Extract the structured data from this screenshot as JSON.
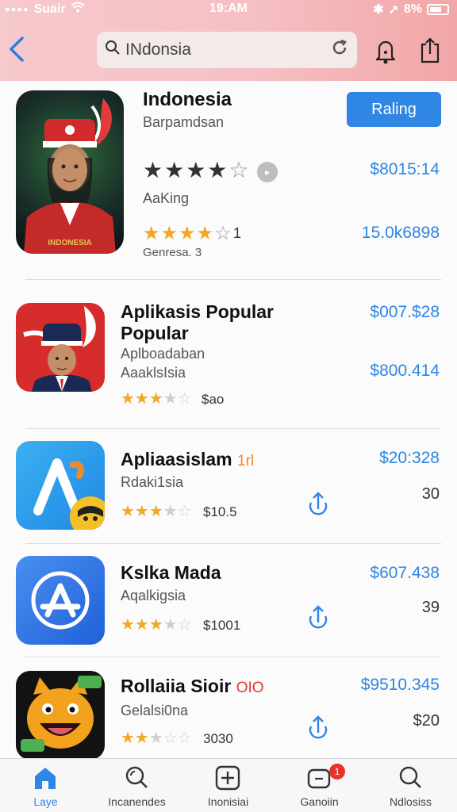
{
  "status_bar": {
    "carrier": "Suair",
    "time": "19:AM",
    "battery": "8%"
  },
  "search": {
    "query": "INdonsia"
  },
  "featured": {
    "title": "Indonesia",
    "subtitle": "Barpamdsan",
    "button": "Raling",
    "price_primary": "$8015:14",
    "label": "AaKing",
    "rating_count": "1",
    "price_secondary": "15.0k6898",
    "genre": "Genresa. 3",
    "image_caption": "INDONESIA"
  },
  "items": [
    {
      "title": "Aplikasis Popular Popular",
      "tag": "",
      "subtitle": "Aplboadaban",
      "subtitle2": "AaaklsIsia",
      "meta": "$ao",
      "price": "$007.$28",
      "price2": "$800.414",
      "rating": 3.5
    },
    {
      "title": "Apliaasislam",
      "tag": "1rl",
      "subtitle": "Rdaki1sia",
      "meta": "$10.5",
      "price": "$20:328",
      "num": "30",
      "rating": 3.5
    },
    {
      "title": "Kslka Mada",
      "tag": "",
      "subtitle": "Aqalkigsia",
      "meta": "$1001",
      "price": "$607.438",
      "num": "39",
      "rating": 3.5
    },
    {
      "title": "Rollaiia Sioir",
      "tag": "OIO",
      "subtitle": "Gelalsi0na",
      "meta": "3030",
      "price": "$9510.345",
      "num": "$20",
      "rating": 2.5
    }
  ],
  "tabs": [
    {
      "label": "Laye",
      "icon": "home-icon",
      "active": true
    },
    {
      "label": "Incanendes",
      "icon": "search-icon",
      "active": false
    },
    {
      "label": "Inonisiai",
      "icon": "plus-icon",
      "active": false
    },
    {
      "label": "Ganoiin",
      "icon": "notification-icon",
      "active": false,
      "badge": "1"
    },
    {
      "label": "Ndlosiss",
      "icon": "search-icon",
      "active": false
    }
  ],
  "colors": {
    "accent": "#2f86e4",
    "star": "#f1a824",
    "header_start": "#f6c9cd",
    "header_end": "#f2a6a6",
    "badge": "#e8332d"
  }
}
